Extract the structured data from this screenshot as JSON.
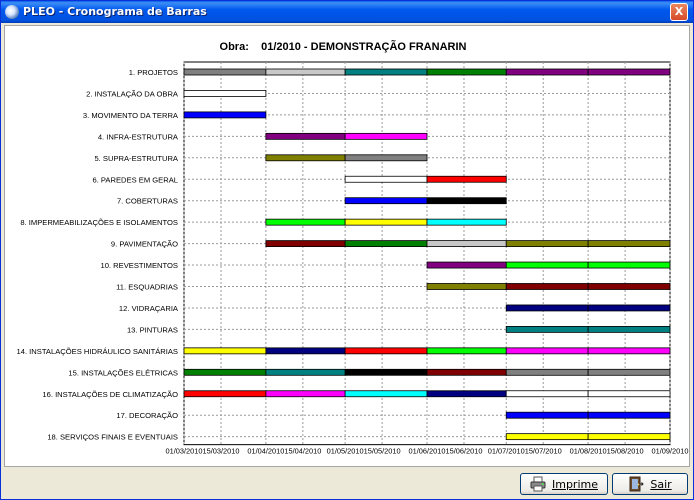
{
  "window": {
    "title": "PLEO - Cronograma de Barras",
    "close_glyph": "X"
  },
  "buttons": {
    "print_label": "Imprime",
    "print_icon": "printer-icon",
    "exit_label": "Sair",
    "exit_icon": "exit-door-icon"
  },
  "chart_data": {
    "type": "gantt",
    "title": "Obra:    01/2010 - DEMONSTRAÇÃO FRANARIN",
    "x_ticks": [
      "01/03/2010",
      "15/03/2010",
      "01/04/2010",
      "15/04/2010",
      "01/05/2010",
      "15/05/2010",
      "01/06/2010",
      "15/06/2010",
      "01/07/2010",
      "15/07/2010",
      "01/08/2010",
      "15/08/2010",
      "01/09/2010"
    ],
    "x_range": [
      "01/03/2010",
      "01/09/2010"
    ],
    "grid": true,
    "tasks": [
      {
        "label": "1.  PROJETOS",
        "segments": [
          {
            "start": "01/03/2010",
            "end": "01/04/2010",
            "color": "#808080"
          },
          {
            "start": "01/04/2010",
            "end": "01/05/2010",
            "color": "#c8c8c8"
          },
          {
            "start": "01/05/2010",
            "end": "01/06/2010",
            "color": "#008080"
          },
          {
            "start": "01/06/2010",
            "end": "01/07/2010",
            "color": "#008000"
          },
          {
            "start": "01/07/2010",
            "end": "01/08/2010",
            "color": "#800080"
          },
          {
            "start": "01/08/2010",
            "end": "01/09/2010",
            "color": "#800080"
          }
        ]
      },
      {
        "label": "2.  INSTALAÇÃO DA OBRA",
        "segments": [
          {
            "start": "01/03/2010",
            "end": "01/04/2010",
            "color": "#ffffff"
          }
        ]
      },
      {
        "label": "3.  MOVIMENTO DA TERRA",
        "segments": [
          {
            "start": "01/03/2010",
            "end": "01/04/2010",
            "color": "#0000ff"
          }
        ]
      },
      {
        "label": "4.  INFRA-ESTRUTURA",
        "segments": [
          {
            "start": "01/04/2010",
            "end": "01/05/2010",
            "color": "#800080"
          },
          {
            "start": "01/05/2010",
            "end": "01/06/2010",
            "color": "#ff00ff"
          }
        ]
      },
      {
        "label": "5.  SUPRA-ESTRUTURA",
        "segments": [
          {
            "start": "01/04/2010",
            "end": "01/05/2010",
            "color": "#808000"
          },
          {
            "start": "01/05/2010",
            "end": "01/06/2010",
            "color": "#808080"
          }
        ]
      },
      {
        "label": "6.  PAREDES EM GERAL",
        "segments": [
          {
            "start": "01/05/2010",
            "end": "01/06/2010",
            "color": "#ffffff"
          },
          {
            "start": "01/06/2010",
            "end": "01/07/2010",
            "color": "#ff0000"
          }
        ]
      },
      {
        "label": "7.  COBERTURAS",
        "segments": [
          {
            "start": "01/05/2010",
            "end": "01/06/2010",
            "color": "#0000ff"
          },
          {
            "start": "01/06/2010",
            "end": "01/07/2010",
            "color": "#000000"
          }
        ]
      },
      {
        "label": "8.  IMPERMEABILIZAÇÕES E ISOLAMENTOS",
        "segments": [
          {
            "start": "01/04/2010",
            "end": "01/05/2010",
            "color": "#00ff00"
          },
          {
            "start": "01/05/2010",
            "end": "01/06/2010",
            "color": "#ffff00"
          },
          {
            "start": "01/06/2010",
            "end": "01/07/2010",
            "color": "#00ffff"
          }
        ]
      },
      {
        "label": "9.  PAVIMENTAÇÃO",
        "segments": [
          {
            "start": "01/04/2010",
            "end": "01/05/2010",
            "color": "#800000"
          },
          {
            "start": "01/05/2010",
            "end": "01/06/2010",
            "color": "#008000"
          },
          {
            "start": "01/06/2010",
            "end": "01/07/2010",
            "color": "#c8c8c8"
          },
          {
            "start": "01/07/2010",
            "end": "01/08/2010",
            "color": "#808000"
          },
          {
            "start": "01/08/2010",
            "end": "01/09/2010",
            "color": "#808000"
          }
        ]
      },
      {
        "label": "10.  REVESTIMENTOS",
        "segments": [
          {
            "start": "01/06/2010",
            "end": "01/07/2010",
            "color": "#800080"
          },
          {
            "start": "01/07/2010",
            "end": "01/08/2010",
            "color": "#00ff00"
          },
          {
            "start": "01/08/2010",
            "end": "01/09/2010",
            "color": "#00ff00"
          }
        ]
      },
      {
        "label": "11.  ESQUADRIAS",
        "segments": [
          {
            "start": "01/06/2010",
            "end": "01/07/2010",
            "color": "#808000"
          },
          {
            "start": "01/07/2010",
            "end": "01/08/2010",
            "color": "#800000"
          },
          {
            "start": "01/08/2010",
            "end": "01/09/2010",
            "color": "#800000"
          }
        ]
      },
      {
        "label": "12.  VIDRAÇARIA",
        "segments": [
          {
            "start": "01/07/2010",
            "end": "01/08/2010",
            "color": "#000080"
          },
          {
            "start": "01/08/2010",
            "end": "01/09/2010",
            "color": "#000080"
          }
        ]
      },
      {
        "label": "13.  PINTURAS",
        "segments": [
          {
            "start": "01/07/2010",
            "end": "01/08/2010",
            "color": "#008080"
          },
          {
            "start": "01/08/2010",
            "end": "01/09/2010",
            "color": "#008080"
          }
        ]
      },
      {
        "label": "14.  INSTALAÇÕES HIDRÁULICO SANITÁRIAS",
        "segments": [
          {
            "start": "01/03/2010",
            "end": "01/04/2010",
            "color": "#ffff00"
          },
          {
            "start": "01/04/2010",
            "end": "01/05/2010",
            "color": "#000080"
          },
          {
            "start": "01/05/2010",
            "end": "01/06/2010",
            "color": "#ff0000"
          },
          {
            "start": "01/06/2010",
            "end": "01/07/2010",
            "color": "#00ff00"
          },
          {
            "start": "01/07/2010",
            "end": "01/08/2010",
            "color": "#ff00ff"
          },
          {
            "start": "01/08/2010",
            "end": "01/09/2010",
            "color": "#ff00ff"
          }
        ]
      },
      {
        "label": "15.  INSTALAÇÕES ELÉTRICAS",
        "segments": [
          {
            "start": "01/03/2010",
            "end": "01/04/2010",
            "color": "#008000"
          },
          {
            "start": "01/04/2010",
            "end": "01/05/2010",
            "color": "#008080"
          },
          {
            "start": "01/05/2010",
            "end": "01/06/2010",
            "color": "#000000"
          },
          {
            "start": "01/06/2010",
            "end": "01/07/2010",
            "color": "#800000"
          },
          {
            "start": "01/07/2010",
            "end": "01/08/2010",
            "color": "#808080"
          },
          {
            "start": "01/08/2010",
            "end": "01/09/2010",
            "color": "#808080"
          }
        ]
      },
      {
        "label": "16.  INSTALAÇÕES DE CLIMATIZAÇÃO",
        "segments": [
          {
            "start": "01/03/2010",
            "end": "01/04/2010",
            "color": "#ff0000"
          },
          {
            "start": "01/04/2010",
            "end": "01/05/2010",
            "color": "#ff00ff"
          },
          {
            "start": "01/05/2010",
            "end": "01/06/2010",
            "color": "#00ffff"
          },
          {
            "start": "01/06/2010",
            "end": "01/07/2010",
            "color": "#000080"
          },
          {
            "start": "01/07/2010",
            "end": "01/08/2010",
            "color": "#ffffff"
          },
          {
            "start": "01/08/2010",
            "end": "01/09/2010",
            "color": "#ffffff"
          }
        ]
      },
      {
        "label": "17.  DECORAÇÃO",
        "segments": [
          {
            "start": "01/07/2010",
            "end": "01/08/2010",
            "color": "#0000ff"
          },
          {
            "start": "01/08/2010",
            "end": "01/09/2010",
            "color": "#0000ff"
          }
        ]
      },
      {
        "label": "18.  SERVIÇOS FINAIS E EVENTUAIS",
        "segments": [
          {
            "start": "01/07/2010",
            "end": "01/08/2010",
            "color": "#ffff00"
          },
          {
            "start": "01/08/2010",
            "end": "01/09/2010",
            "color": "#ffff00"
          }
        ]
      }
    ]
  }
}
